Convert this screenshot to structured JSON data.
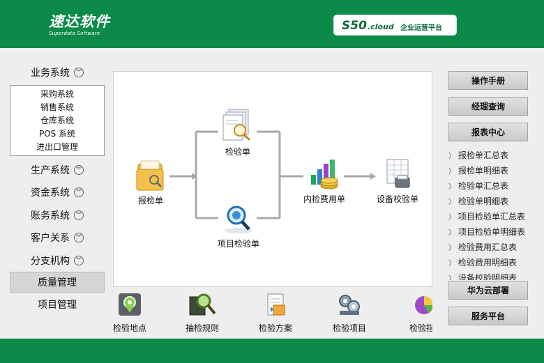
{
  "header": {
    "logo_title": "速达软件",
    "logo_subtitle": "Superdata Software",
    "product_name": "S50",
    "product_suffix": ".cloud",
    "product_tagline": "企业运营平台"
  },
  "sidebar": {
    "items": [
      {
        "label": "业务系统"
      },
      {
        "label": "生产系统"
      },
      {
        "label": "资金系统"
      },
      {
        "label": "账务系统"
      },
      {
        "label": "客户关系"
      },
      {
        "label": "分支机构"
      },
      {
        "label": "质量管理"
      },
      {
        "label": "项目管理"
      }
    ],
    "submenu": [
      {
        "label": "采购系统"
      },
      {
        "label": "销售系统"
      },
      {
        "label": "仓库系统"
      },
      {
        "label": "POS 系统"
      },
      {
        "label": "进出口管理"
      }
    ],
    "active": "质量管理"
  },
  "flow": {
    "nodes": [
      {
        "label": "报检单",
        "icon": "folder-magnifier-icon"
      },
      {
        "label": "检验单",
        "icon": "documents-magnifier-icon"
      },
      {
        "label": "项目检验单",
        "icon": "blue-magnifier-icon"
      },
      {
        "label": "内检费用单",
        "icon": "chart-coins-icon"
      },
      {
        "label": "设备校验单",
        "icon": "spreadsheet-printer-icon"
      }
    ]
  },
  "shortcuts": [
    {
      "label": "检验地点",
      "icon": "map-pin-icon"
    },
    {
      "label": "抽检规则",
      "icon": "magnifier-board-icon"
    },
    {
      "label": "检验方案",
      "icon": "document-plan-icon"
    },
    {
      "label": "检验项目",
      "icon": "gears-icon"
    },
    {
      "label": "检验指",
      "icon": "pie-chart-icon"
    }
  ],
  "right": {
    "btn_manual": "操作手册",
    "btn_manager": "经理查询",
    "btn_reports": "报表中心",
    "reports": [
      "报检单汇总表",
      "报检单明细表",
      "检验单汇总表",
      "检验单明细表",
      "项目检验单汇总表",
      "项目检验单明细表",
      "检验费用汇总表",
      "检验费用明细表",
      "设备校验明细表"
    ],
    "btn_huawei": "华为云部署",
    "btn_service": "服务平台"
  },
  "colors": {
    "brand_green": "#0c8a49",
    "background": "#eeeeee"
  }
}
